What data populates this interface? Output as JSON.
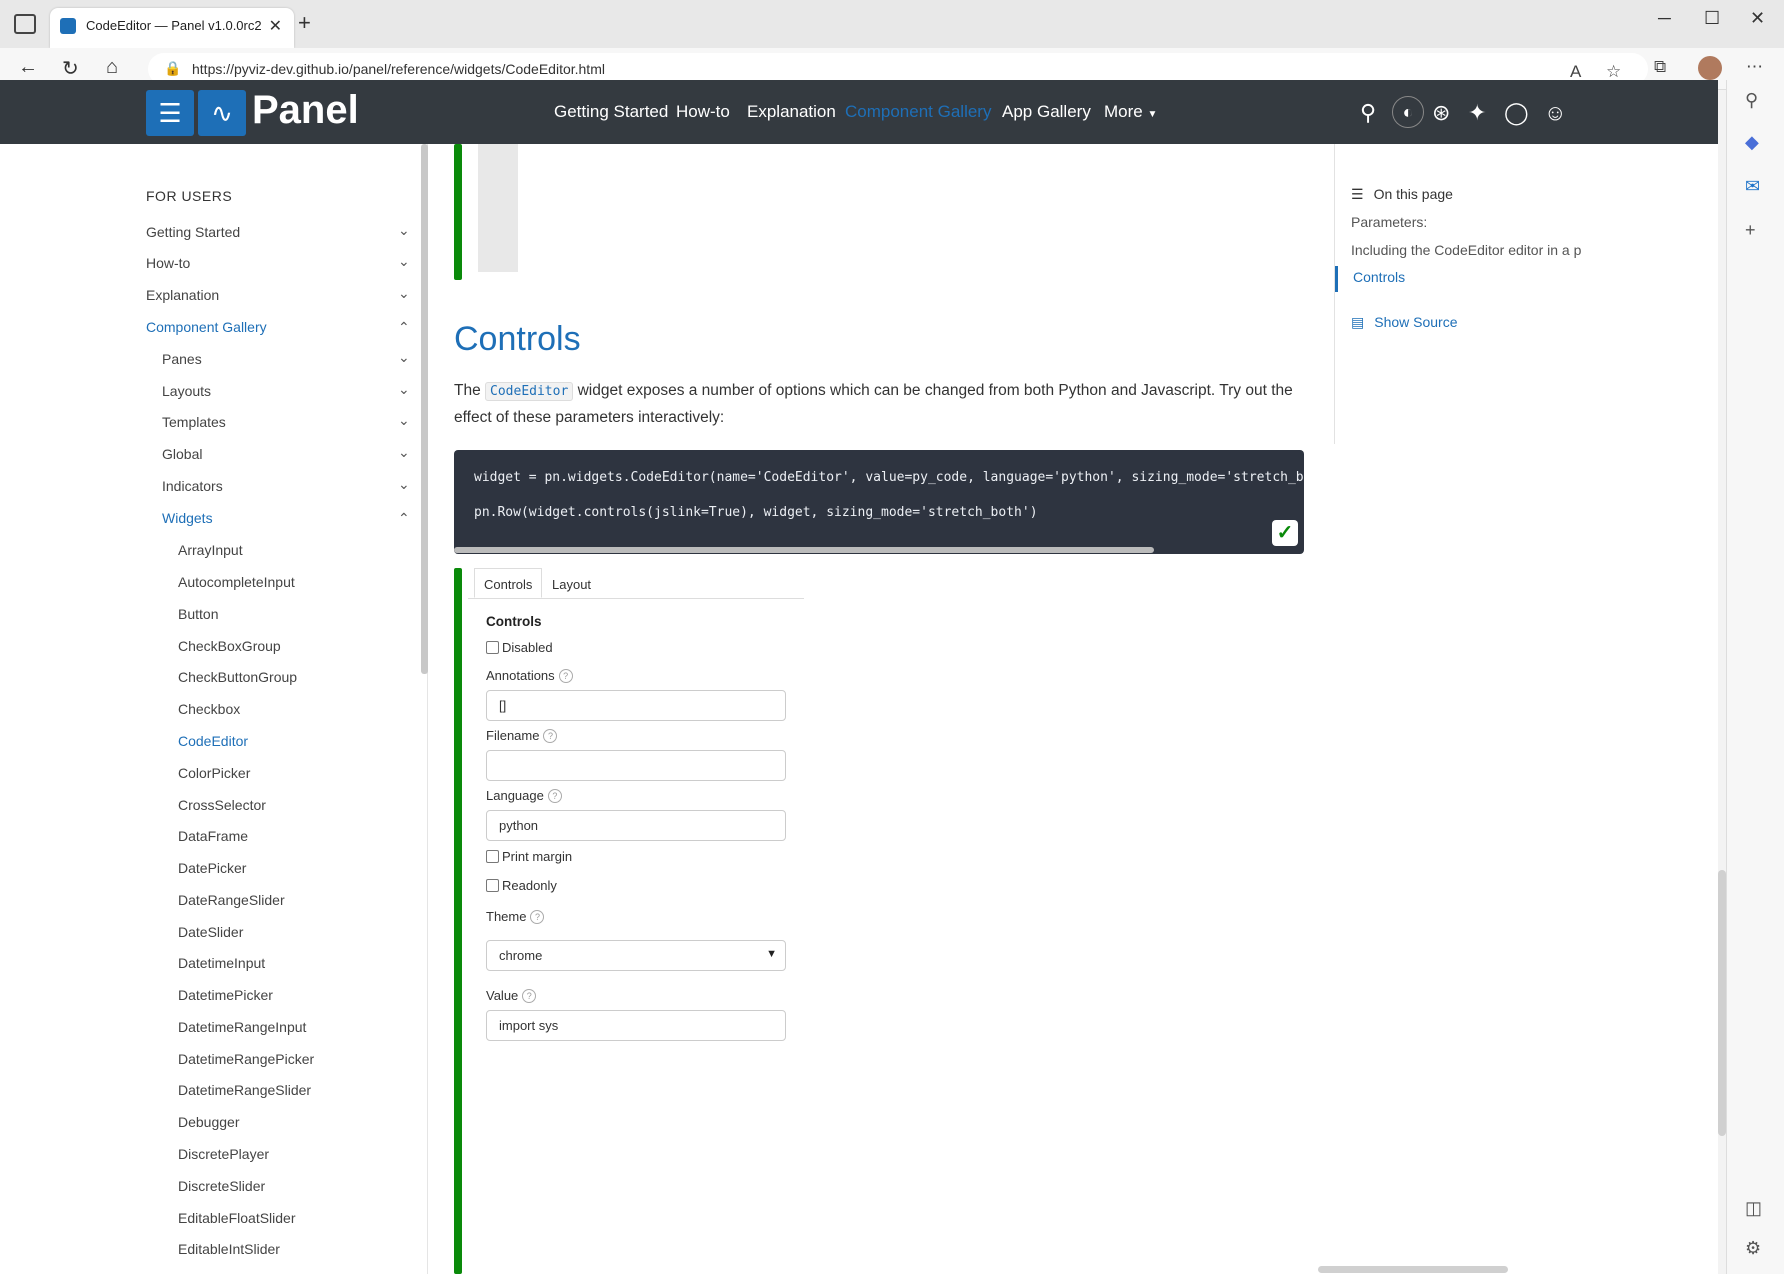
{
  "browser": {
    "tab_title": "CodeEditor — Panel v1.0.0rc2",
    "url": "https://pyviz-dev.github.io/panel/reference/widgets/CodeEditor.html"
  },
  "topnav": {
    "brand": "Panel",
    "links": [
      "Getting Started",
      "How-to",
      "Explanation",
      "Component Gallery",
      "App Gallery",
      "More"
    ],
    "active": "Component Gallery"
  },
  "sidebar": {
    "heading": "FOR USERS",
    "top": [
      "Getting Started",
      "How-to",
      "Explanation",
      "Component Gallery"
    ],
    "gallery": [
      "Panes",
      "Layouts",
      "Templates",
      "Global",
      "Indicators",
      "Widgets"
    ],
    "widgets": [
      "ArrayInput",
      "AutocompleteInput",
      "Button",
      "CheckBoxGroup",
      "CheckButtonGroup",
      "Checkbox",
      "CodeEditor",
      "ColorPicker",
      "CrossSelector",
      "DataFrame",
      "DatePicker",
      "DateRangeSlider",
      "DateSlider",
      "DatetimeInput",
      "DatetimePicker",
      "DatetimeRangeInput",
      "DatetimeRangePicker",
      "DatetimeRangeSlider",
      "Debugger",
      "DiscretePlayer",
      "DiscreteSlider",
      "EditableFloatSlider",
      "EditableIntSlider"
    ],
    "active_widget": "CodeEditor"
  },
  "main": {
    "heading": "Controls",
    "para_before": "The ",
    "para_code": "CodeEditor",
    "para_after": " widget exposes a number of options which can be changed from both Python and Javascript. Try out the effect of these parameters interactively:",
    "code_line1": "widget = pn.widgets.CodeEditor(name='CodeEditor', value=py_code, language='python', sizing_mode='stretch_both')",
    "code_line2": "pn.Row(widget.controls(jslink=True), widget, sizing_mode='stretch_both')"
  },
  "controls": {
    "tabs": [
      "Controls",
      "Layout"
    ],
    "title": "Controls",
    "disabled_label": "Disabled",
    "annotations_label": "Annotations",
    "annotations_value": "[]",
    "filename_label": "Filename",
    "filename_value": "",
    "language_label": "Language",
    "language_value": "python",
    "print_margin_label": "Print margin",
    "readonly_label": "Readonly",
    "theme_label": "Theme",
    "theme_value": "chrome",
    "value_label": "Value",
    "value_value": "import sys"
  },
  "toc": {
    "heading": "On this page",
    "items": [
      "Parameters:",
      "Including the CodeEditor editor in a p",
      "Controls"
    ],
    "active": "Controls",
    "show_source": "Show Source"
  }
}
